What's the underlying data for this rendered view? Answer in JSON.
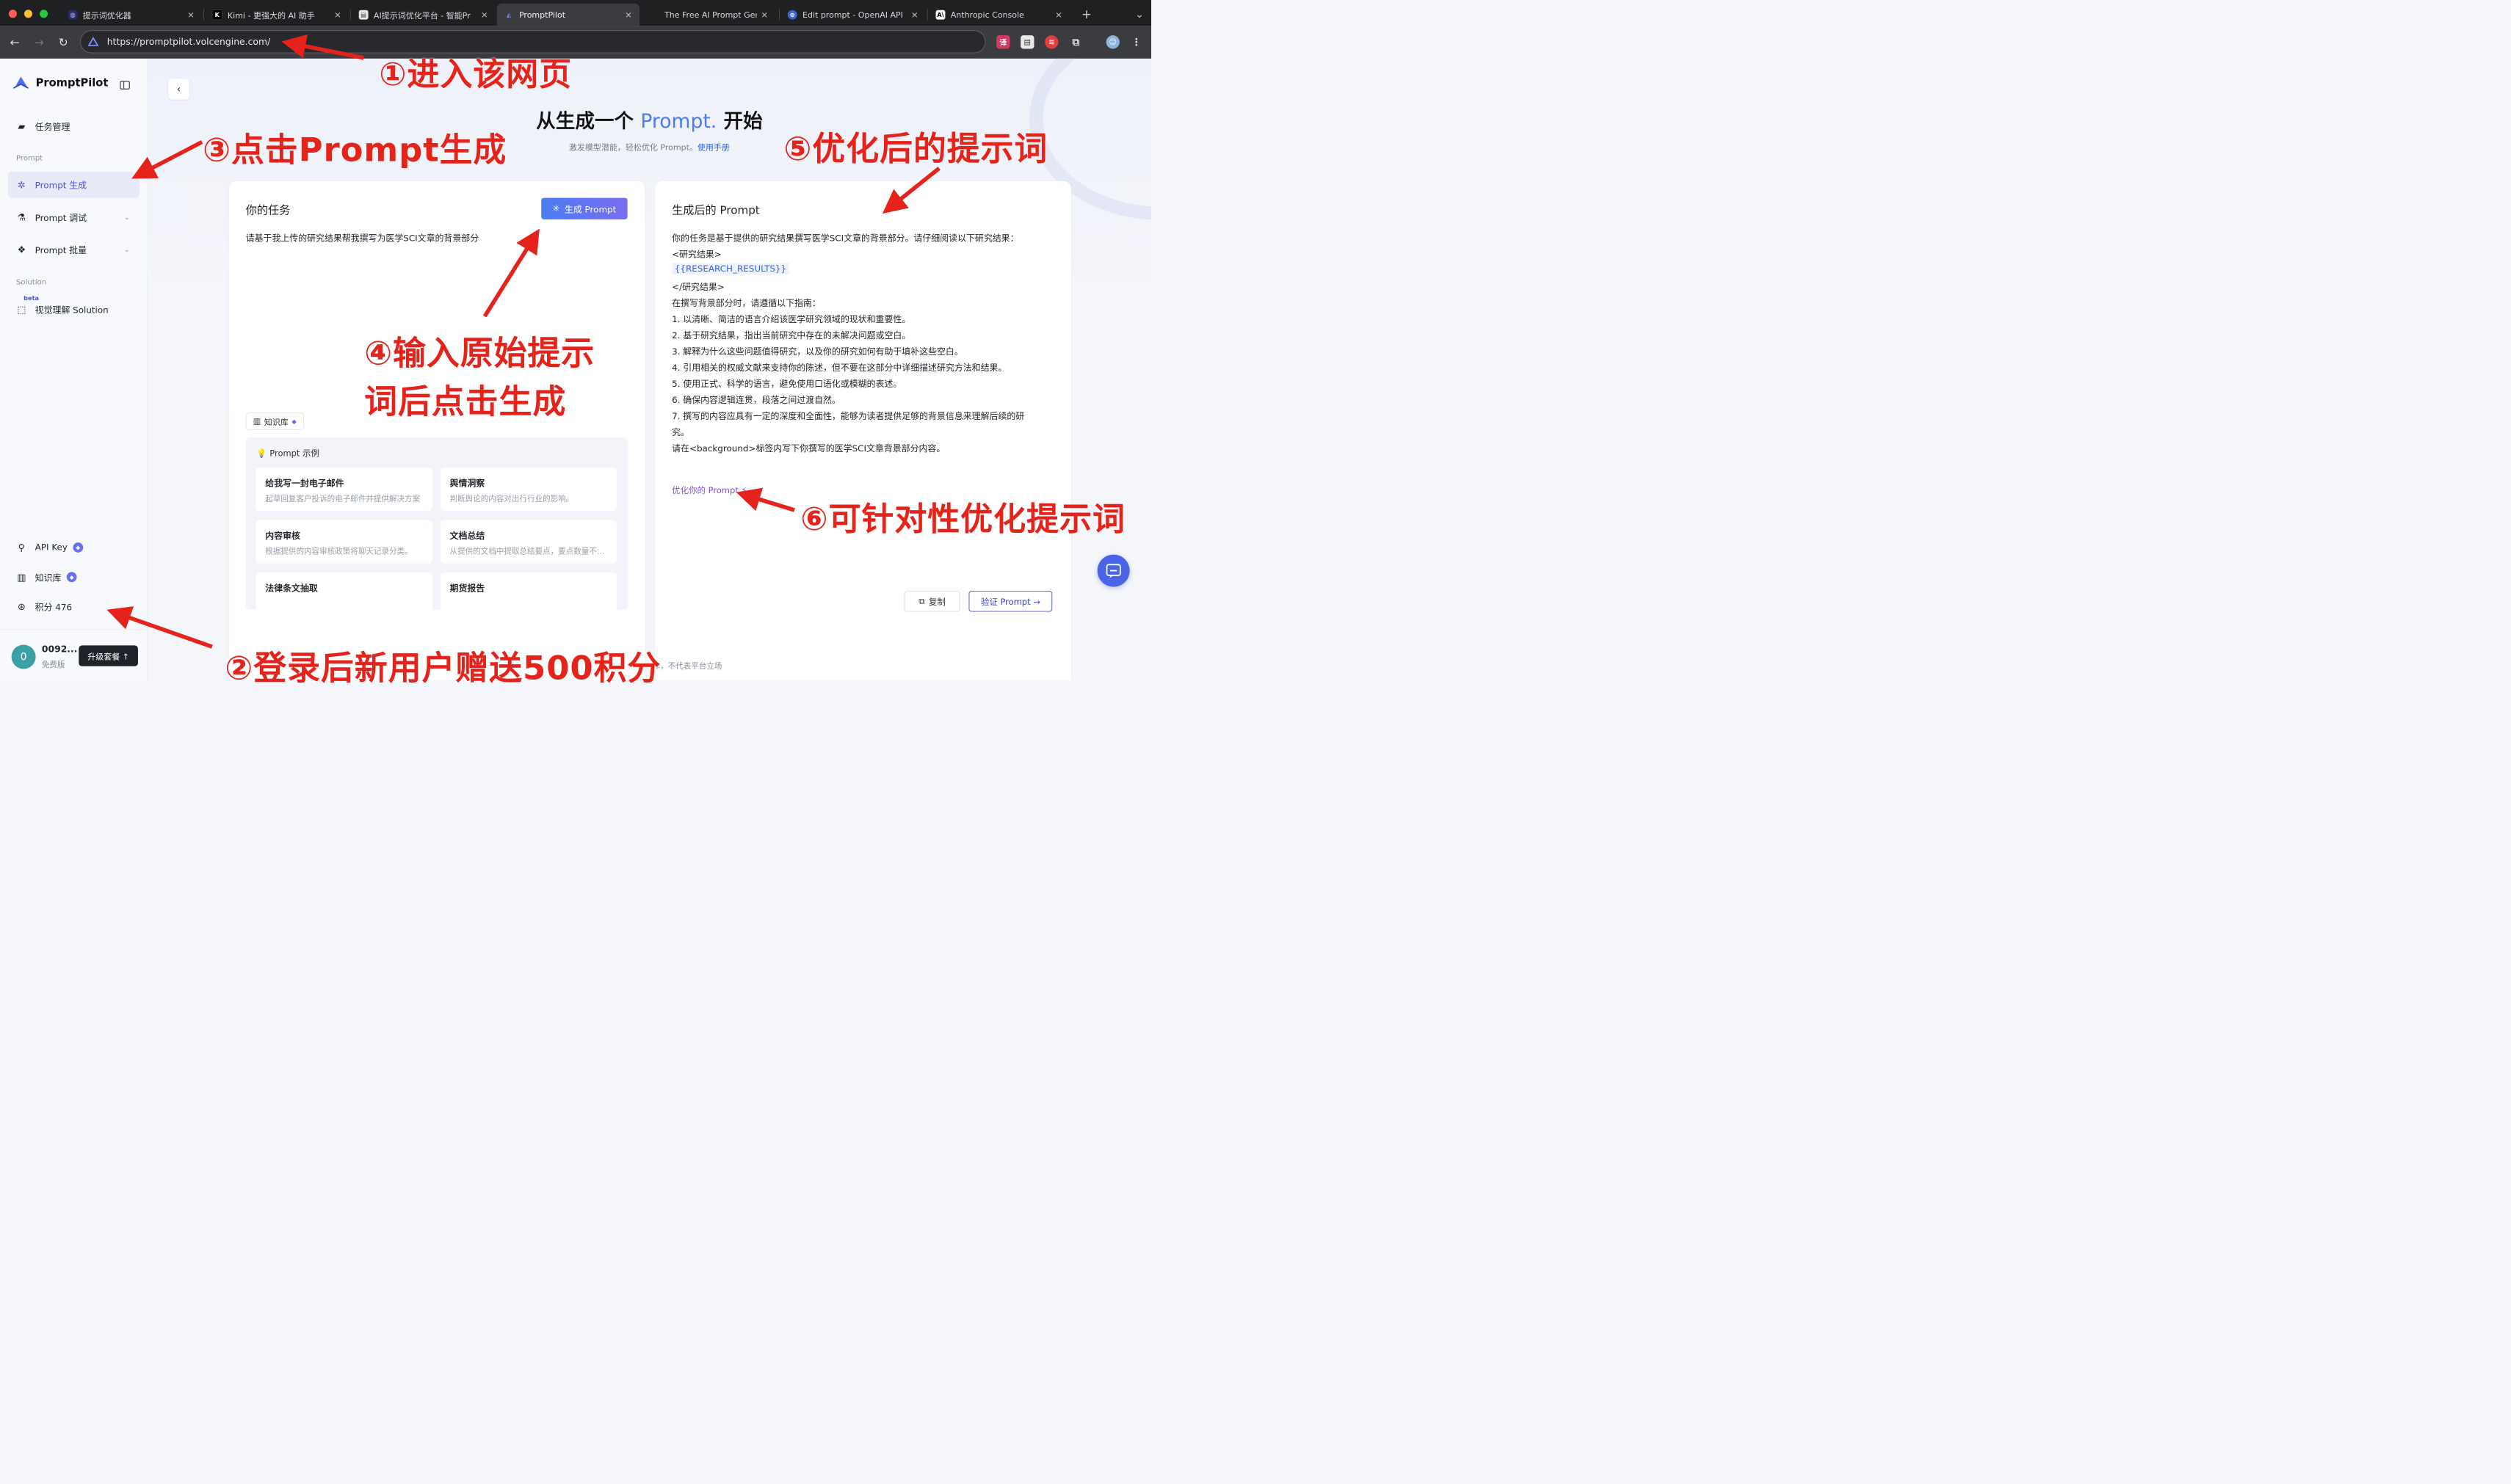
{
  "browser": {
    "tabs": [
      {
        "title": "提示词优化器",
        "icon": "shield-icon"
      },
      {
        "title": "Kimi - 更强大的 AI 助手",
        "icon": "kimi-k-icon"
      },
      {
        "title": "AI提示词优化平台 - 智能Pr",
        "icon": "document-icon"
      },
      {
        "title": "PromptPilot",
        "icon": "promptpilot-icon",
        "active": true
      },
      {
        "title": "The Free AI Prompt Gene",
        "icon": "blank-icon"
      },
      {
        "title": "Edit prompt - OpenAI API",
        "icon": "openai-icon"
      },
      {
        "title": "Anthropic Console",
        "icon": "anthropic-icon"
      }
    ],
    "new_tab": "+",
    "close": "×",
    "url": "https://promptpilot.volcengine.com/"
  },
  "sidebar": {
    "app_name": "PromptPilot",
    "items": [
      {
        "label": "任务管理"
      },
      {
        "section": "Prompt"
      },
      {
        "label": "Prompt 生成",
        "active": true
      },
      {
        "label": "Prompt 调试"
      },
      {
        "label": "Prompt 批量"
      },
      {
        "section": "Solution"
      },
      {
        "label": "视觉理解 Solution",
        "badge": "beta"
      }
    ],
    "bottom": {
      "api_key": "API Key",
      "kb": "知识库",
      "points": "积分 476"
    },
    "user": {
      "avatar_letter": "0",
      "name": "0092...",
      "plan": "免费版",
      "upgrade": "升级套餐 ↑"
    }
  },
  "main": {
    "hero_prefix": "从生成一个",
    "hero_highlight": "Prompt.",
    "hero_suffix": "开始",
    "subtitle": "激发模型潜能，轻松优化 Prompt。",
    "manual_link": "使用手册",
    "task_card": {
      "title": "你的任务",
      "generate_button": "生成 Prompt",
      "input_text": "请基于我上传的研究结果帮我撰写为医学SCI文章的背景部分",
      "kb_chip": "知识库",
      "examples_title": "Prompt 示例",
      "examples": [
        {
          "title": "给我写一封电子邮件",
          "desc": "起草回复客户投诉的电子邮件并提供解决方案"
        },
        {
          "title": "舆情洞察",
          "desc": "判断舆论的内容对出行行业的影响。"
        },
        {
          "title": "内容审核",
          "desc": "根据提供的内容审核政策将聊天记录分类。"
        },
        {
          "title": "文档总结",
          "desc": "从提供的文档中提取总结要点，要点数量不超过"
        },
        {
          "title": "法律条文抽取",
          "desc": ""
        },
        {
          "title": "期货报告",
          "desc": ""
        }
      ]
    },
    "output_card": {
      "title": "生成后的 Prompt",
      "lines": [
        "你的任务是基于提供的研究结果撰写医学SCI文章的背景部分。请仔细阅读以下研究结果：",
        "<研究结果>",
        "{{RESEARCH_RESULTS}}",
        "</研究结果>",
        "在撰写背景部分时，请遵循以下指南：",
        "1. 以清晰、简洁的语言介绍该医学研究领域的现状和重要性。",
        "2. 基于研究结果，指出当前研究中存在的未解决问题或空白。",
        "3. 解释为什么这些问题值得研究，以及你的研究如何有助于填补这些空白。",
        "4. 引用相关的权威文献来支持你的陈述，但不要在这部分中详细描述研究方法和结果。",
        "5. 使用正式、科学的语言，避免使用口语化或模糊的表述。",
        "6. 确保内容逻辑连贯，段落之间过渡自然。",
        "7. 撰写的内容应具有一定的深度和全面性，能够为读者提供足够的背景信息来理解后续的研",
        "究。",
        "请在<background>标签内写下你撰写的医学SCI文章背景部分内容。"
      ],
      "optimize_link": "优化你的 Prompt",
      "copy_button": "复制",
      "verify_button": "验证 Prompt →"
    },
    "footer": "作，不代表平台立场"
  },
  "annotations": [
    "①进入该网页",
    "②登录后新用户赠送500积分",
    "③点击Prompt生成",
    "④输入原始提示",
    "词后点击生成",
    "⑤优化后的提示词",
    "⑥可针对性优化提示词"
  ],
  "colors": {
    "accent": "#4b55d6",
    "annotation_red": "#e5231b",
    "link_purple": "#8b4fd8"
  }
}
